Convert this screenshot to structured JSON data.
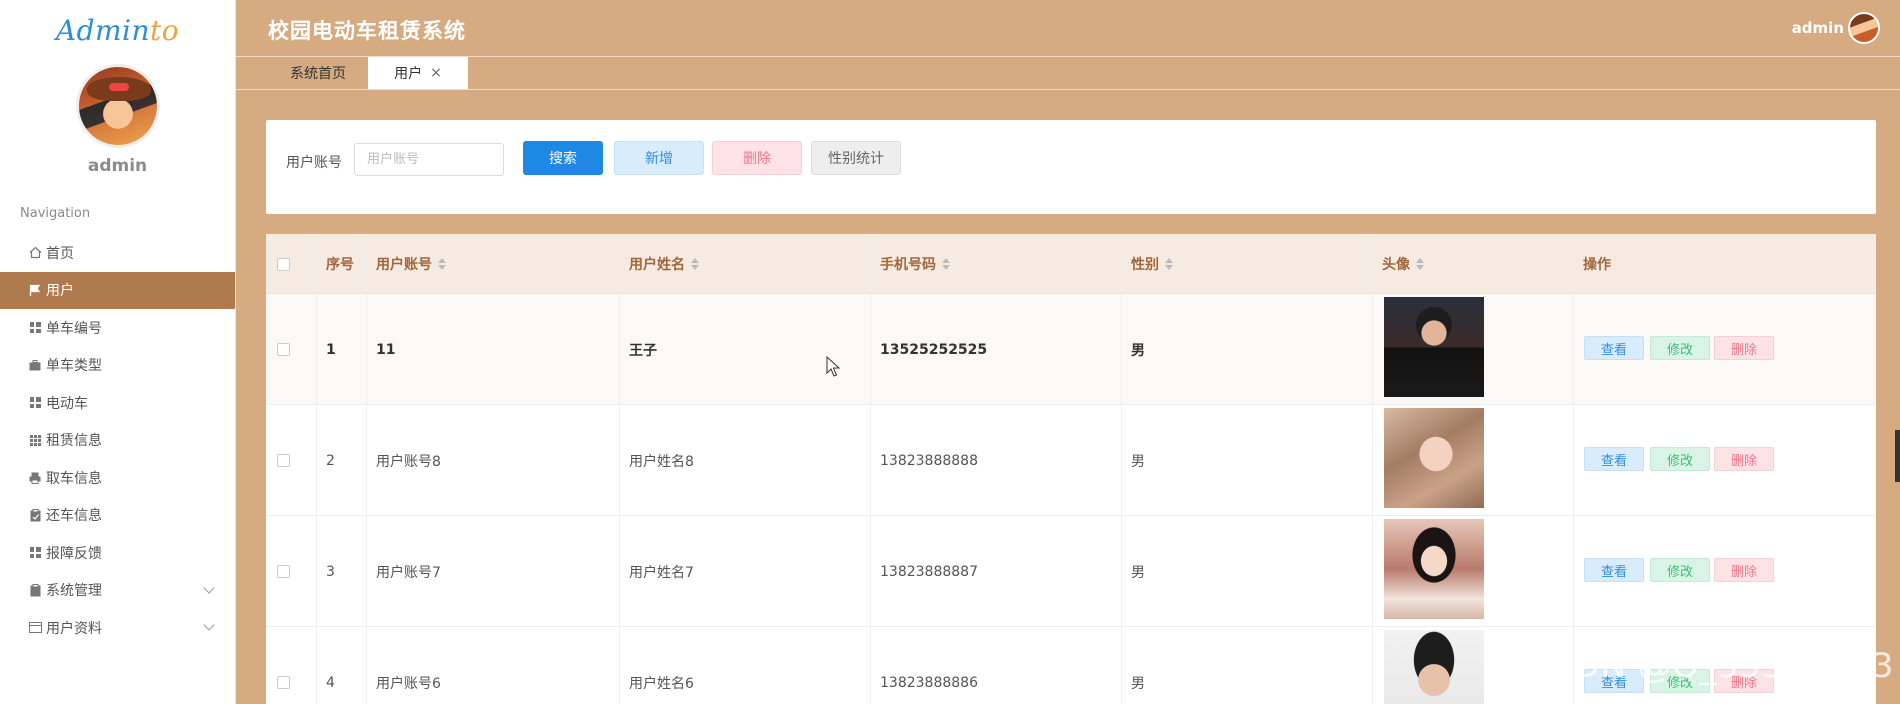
{
  "sidebar": {
    "logo_main": "Admin",
    "logo_accent": "to",
    "username": "admin",
    "nav_title": "Navigation",
    "items": [
      {
        "label": "首页"
      },
      {
        "label": "用户"
      },
      {
        "label": "单车编号"
      },
      {
        "label": "单车类型"
      },
      {
        "label": "电动车"
      },
      {
        "label": "租赁信息"
      },
      {
        "label": "取车信息"
      },
      {
        "label": "还车信息"
      },
      {
        "label": "报障反馈"
      },
      {
        "label": "系统管理"
      },
      {
        "label": "用户资料"
      }
    ]
  },
  "header": {
    "title": "校园电动车租赁系统",
    "user": "admin"
  },
  "tabs": {
    "home": "系统首页",
    "user": "用户",
    "close": "×"
  },
  "search": {
    "label": "用户账号",
    "placeholder": "用户账号",
    "btn_search": "搜索",
    "btn_add": "新增",
    "btn_delete": "删除",
    "btn_stats": "性别统计"
  },
  "table": {
    "headers": {
      "index": "序号",
      "account": "用户账号",
      "name": "用户姓名",
      "phone": "手机号码",
      "gender": "性别",
      "avatar": "头像",
      "actions": "操作"
    },
    "rows": [
      {
        "index": "1",
        "account": "11",
        "name": "王子",
        "phone": "13525252525",
        "gender": "男"
      },
      {
        "index": "2",
        "account": "用户账号8",
        "name": "用户姓名8",
        "phone": "13823888888",
        "gender": "男"
      },
      {
        "index": "3",
        "account": "用户账号7",
        "name": "用户姓名7",
        "phone": "13823888887",
        "gender": "男"
      },
      {
        "index": "4",
        "account": "用户账号6",
        "name": "用户姓名6",
        "phone": "13823888886",
        "gender": "男"
      }
    ],
    "action_view": "查看",
    "action_edit": "修改",
    "action_delete": "删除"
  },
  "watermark": "CSDN @Q_55318293"
}
